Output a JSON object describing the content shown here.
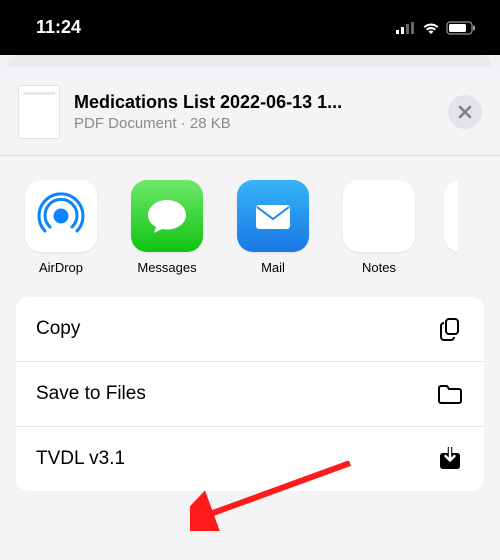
{
  "status": {
    "time": "11:24"
  },
  "document": {
    "title": "Medications List 2022-06-13 1...",
    "subtitle": "PDF Document · 28 KB"
  },
  "apps": [
    {
      "label": "AirDrop"
    },
    {
      "label": "Messages"
    },
    {
      "label": "Mail"
    },
    {
      "label": "Notes"
    }
  ],
  "actions": [
    {
      "label": "Copy"
    },
    {
      "label": "Save to Files"
    },
    {
      "label": "TVDL v3.1"
    }
  ]
}
